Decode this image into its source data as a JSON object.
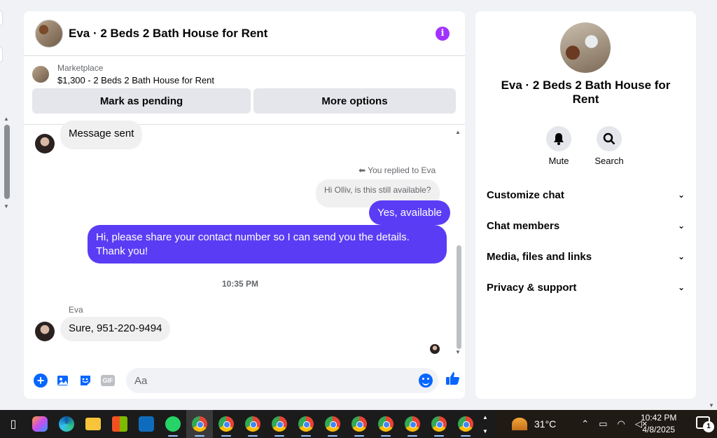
{
  "chat": {
    "title": "Eva · 2 Beds 2 Bath House for Rent",
    "marketplace": {
      "label": "Marketplace",
      "listing": "$1,300 - 2 Beds 2 Bath House for Rent",
      "buttons": [
        "Mark as pending",
        "More options"
      ]
    },
    "messages": {
      "first_in": "Message sent",
      "reply_note": "You replied to Eva",
      "quoted": "Hi Olliv, is this still available?",
      "out1": "Yes, available",
      "out2": "Hi, please share your contact number so I can send you the details. Thank you!",
      "timestamp": "10:35 PM",
      "sender": "Eva",
      "in_last": "Sure, 951-220-9494"
    },
    "composer": {
      "placeholder": "Aa",
      "gif_label": "GIF"
    }
  },
  "panel": {
    "title": "Eva · 2 Beds 2 Bath House for Rent",
    "actions": [
      "Mute",
      "Search"
    ],
    "menu": [
      "Customize chat",
      "Chat members",
      "Media, files and links",
      "Privacy & support"
    ]
  },
  "taskbar": {
    "temperature": "31°C",
    "time": "10:42 PM",
    "date": "4/8/2025",
    "notification_count": "1",
    "apps": [
      "task-view",
      "copilot",
      "edge",
      "file-explorer",
      "store",
      "outlook",
      "whatsapp",
      "chrome",
      "chrome",
      "chrome",
      "chrome",
      "chrome",
      "chrome",
      "chrome",
      "chrome",
      "chrome",
      "chrome",
      "chrome"
    ]
  },
  "colors": {
    "accent_blue": "#0866ff",
    "outgoing_bubble": "#5b3cf5",
    "info_purple": "#a033ff"
  }
}
